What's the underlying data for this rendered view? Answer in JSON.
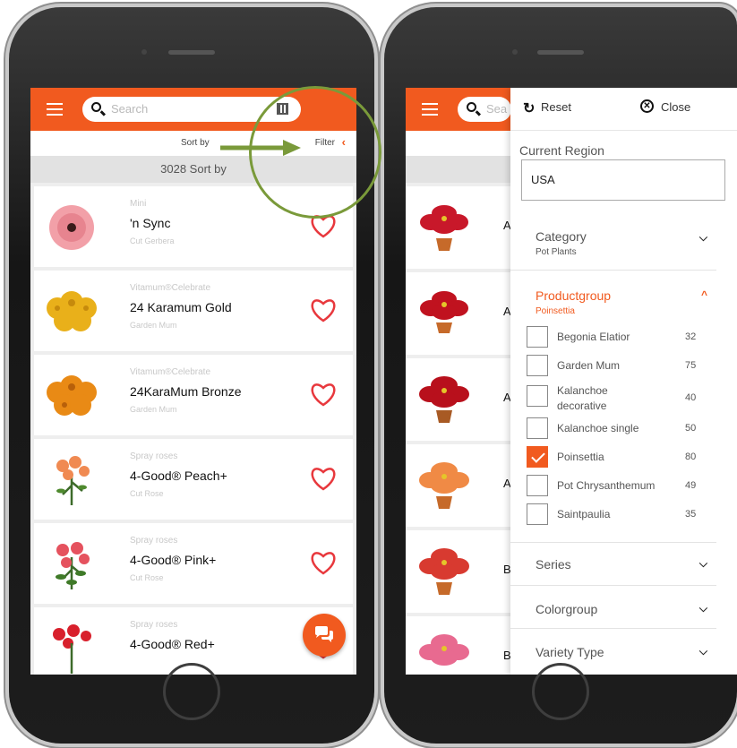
{
  "left_screen": {
    "search_placeholder": "Search",
    "sort_label": "Sort by",
    "filter_label": "Filter",
    "filter_chevron": "‹",
    "count_label": "3028 Sort by",
    "products": [
      {
        "series": "Mini",
        "name": "'n Sync",
        "type": "Cut Gerbera",
        "icon": "pink-gerbera"
      },
      {
        "series": "Vitamum®Celebrate",
        "name": "24 Karamum Gold",
        "type": "Garden Mum",
        "icon": "yellow-mum"
      },
      {
        "series": "Vitamum®Celebrate",
        "name": "24KaraMum Bronze",
        "type": "Garden Mum",
        "icon": "orange-mum"
      },
      {
        "series": "Spray roses",
        "name": "4-Good® Peach+",
        "type": "Cut Rose",
        "icon": "peach-rose"
      },
      {
        "series": "Spray roses",
        "name": "4-Good® Pink+",
        "type": "Cut Rose",
        "icon": "pink-rose"
      },
      {
        "series": "Spray roses",
        "name": "4-Good® Red+",
        "type": "",
        "icon": "red-rose"
      }
    ]
  },
  "right_screen": {
    "search_placeholder": "Sea",
    "list_letters": [
      "A",
      "A",
      "A",
      "A",
      "B",
      "B"
    ],
    "filter_panel": {
      "reset_label": "Reset",
      "close_label": "Close",
      "current_region_label": "Current Region",
      "region_value": "USA",
      "category": {
        "title": "Category",
        "selected": "Pot Plants"
      },
      "productgroup": {
        "title": "Productgroup",
        "selected": "Poinsettia",
        "options": [
          {
            "label": "Begonia Elatior",
            "count": "32",
            "checked": false
          },
          {
            "label": "Garden Mum",
            "count": "75",
            "checked": false
          },
          {
            "label": "Kalanchoe decorative",
            "count": "40",
            "checked": false
          },
          {
            "label": "Kalanchoe single",
            "count": "50",
            "checked": false
          },
          {
            "label": "Poinsettia",
            "count": "80",
            "checked": true
          },
          {
            "label": "Pot Chrysanthemum",
            "count": "49",
            "checked": false
          },
          {
            "label": "Saintpaulia",
            "count": "35",
            "checked": false
          }
        ]
      },
      "series": {
        "title": "Series"
      },
      "colorgroup": {
        "title": "Colorgroup"
      },
      "variety_type": {
        "title": "Variety Type"
      }
    }
  },
  "colors": {
    "accent": "#f15a1f",
    "annotation": "#7a9a3a"
  }
}
